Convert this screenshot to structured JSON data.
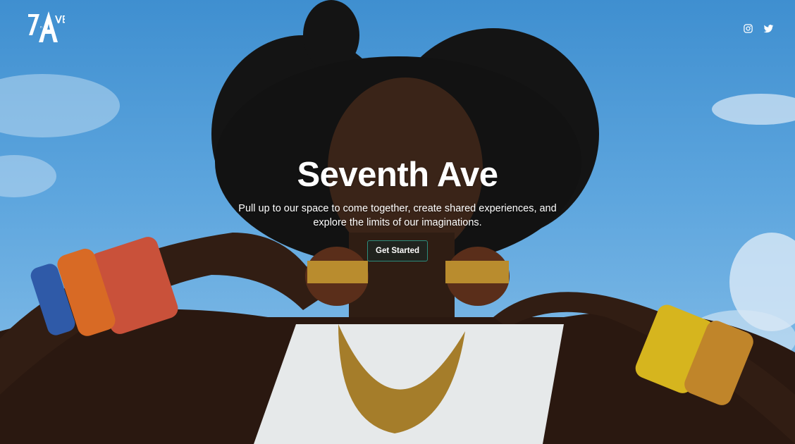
{
  "brand": {
    "logo_text": "7AVE"
  },
  "hero": {
    "title": "Seventh Ave",
    "subtitle": "Pull up to our space to come together, create shared experiences, and explore the limits of our imaginations.",
    "cta_label": "Get Started"
  },
  "social": [
    {
      "icon": "instagram-icon"
    },
    {
      "icon": "twitter-icon"
    }
  ],
  "colors": {
    "sky": "#5ea6de",
    "cta_border": "#2c8c7c",
    "text": "#ffffff"
  }
}
